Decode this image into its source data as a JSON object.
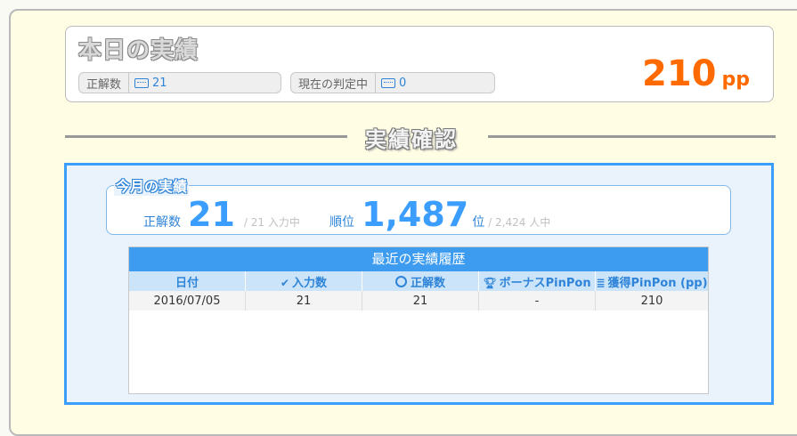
{
  "today": {
    "title": "本日の実績",
    "correct_label": "正解数",
    "correct_value": "21",
    "judging_label": "現在の判定中",
    "judging_value": "0",
    "pp_value": "210",
    "pp_unit": "pp"
  },
  "section_title": "実績確認",
  "month": {
    "title": "今月の実績",
    "correct_label": "正解数",
    "correct_value": "21",
    "correct_sub": "/ 21 入力中",
    "rank_label": "順位",
    "rank_value": "1,487",
    "rank_unit": "位",
    "rank_sub": "/ 2,424 人中"
  },
  "history": {
    "title": "最近の実績履歴",
    "columns": [
      "日付",
      "入力数",
      "正解数",
      "ボーナスPinPon",
      "獲得PinPon (pp)"
    ],
    "rows": [
      [
        "2016/07/05",
        "21",
        "21",
        "-",
        "210"
      ]
    ]
  },
  "colors": {
    "accent_orange": "#ff6a00",
    "accent_blue": "#3b9eff"
  }
}
